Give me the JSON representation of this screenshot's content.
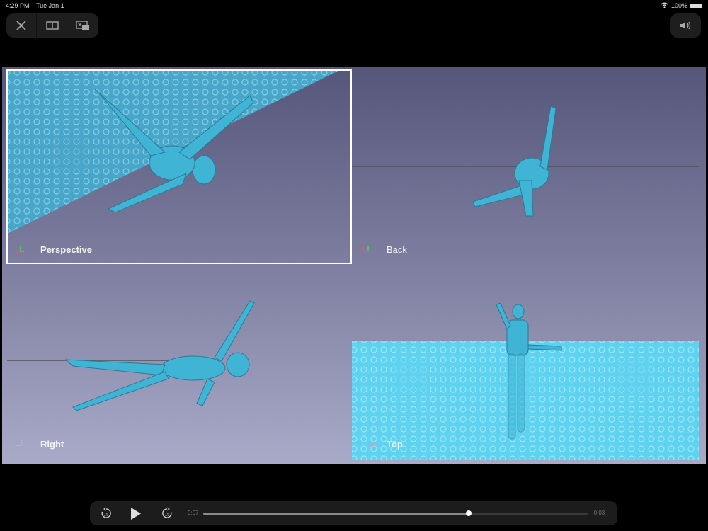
{
  "status": {
    "time": "4:29 PM",
    "date": "Tue Jan 1",
    "battery": "100%"
  },
  "player": {
    "elapsed": "0:07",
    "remaining": "-0:03",
    "progress": 0.69,
    "skip_back": "15",
    "skip_fwd": "15"
  },
  "viewports": [
    {
      "label": "Perspective",
      "active": true
    },
    {
      "label": "Back"
    },
    {
      "label": "Right"
    },
    {
      "label": "Top"
    }
  ],
  "colors": {
    "figure": "#3fb4d4",
    "accent": "#ffffff"
  }
}
